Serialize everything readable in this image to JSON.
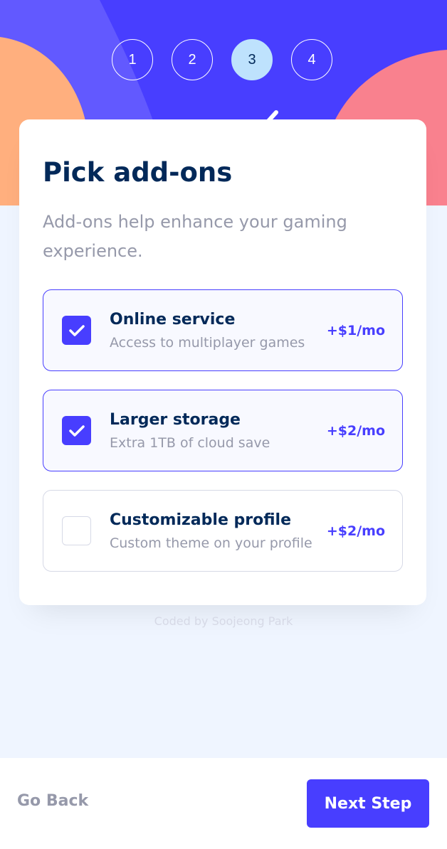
{
  "steps": [
    "1",
    "2",
    "3",
    "4"
  ],
  "active_step": 3,
  "title": "Pick add-ons",
  "subtitle": "Add-ons help enhance your gaming experience.",
  "addons": [
    {
      "name": "Online service",
      "description": "Access to multiplayer games",
      "price": "+$1/mo",
      "selected": true
    },
    {
      "name": "Larger storage",
      "description": "Extra 1TB of cloud save",
      "price": "+$2/mo",
      "selected": true
    },
    {
      "name": "Customizable profile",
      "description": "Custom theme on your profile",
      "price": "+$2/mo",
      "selected": false
    }
  ],
  "credit": "Coded by Soojeong Park",
  "footer": {
    "back_label": "Go Back",
    "next_label": "Next Step"
  },
  "colors": {
    "accent": "#483eff",
    "denim": "#022959",
    "grey": "#9699aa",
    "light_blue": "#bee2fd",
    "orange": "#ffaf7e",
    "pink": "#f9818e",
    "background": "#eff5ff"
  }
}
